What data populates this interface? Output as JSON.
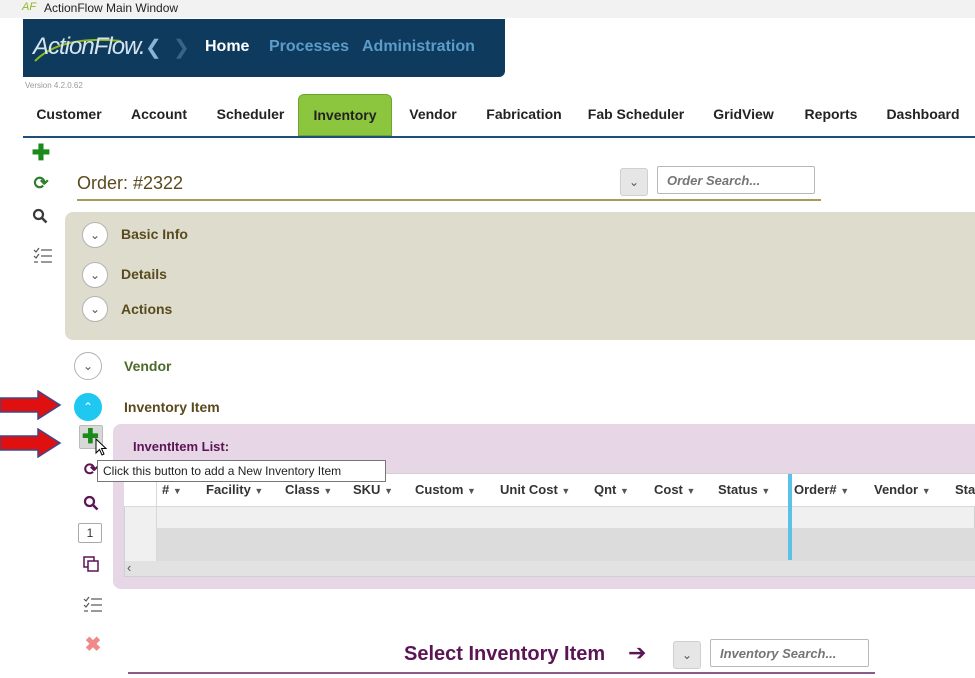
{
  "window": {
    "logo_text": "AF",
    "title": "ActionFlow Main Window"
  },
  "header": {
    "brand": "ActionFlow.",
    "nav": {
      "home": "Home",
      "processes": "Processes",
      "administration": "Administration"
    },
    "version": "Version 4.2.0.62"
  },
  "tabs": [
    "Customer",
    "Account",
    "Scheduler",
    "Inventory",
    "Vendor",
    "Fabrication",
    "Fab Scheduler",
    "GridView",
    "Reports",
    "Dashboard"
  ],
  "active_tab": "Inventory",
  "order": {
    "label": "Order:  #2322",
    "search_placeholder": "Order Search..."
  },
  "sections": {
    "basic_info": "Basic Info",
    "details": "Details",
    "actions": "Actions",
    "vendor": "Vendor",
    "inventory_item": "Inventory Item"
  },
  "inventory_list": {
    "title": "InventItem List:",
    "columns": [
      "#",
      "Facility",
      "Class",
      "SKU",
      "Custom",
      "Unit Cost",
      "Qnt",
      "Cost",
      "Status",
      "Order#",
      "Vendor",
      "Sta"
    ],
    "page": "1"
  },
  "tooltip": "Click this button to add a New Inventory Item",
  "select_inventory": {
    "label": "Select Inventory Item",
    "search_placeholder": "Inventory Search..."
  },
  "colors": {
    "header_bg": "#0e3a5e",
    "active_tab": "#8cc63f",
    "panel_beige": "#deddcd",
    "panel_purple": "#e6d6e6",
    "accent_cyan": "#1ec8f0",
    "annotation_red": "#e01010"
  },
  "icons": {
    "add": "plus-icon",
    "refresh": "refresh-icon",
    "search": "search-icon",
    "checklist": "checklist-icon",
    "delete": "close-icon",
    "copy": "copy-icon"
  }
}
